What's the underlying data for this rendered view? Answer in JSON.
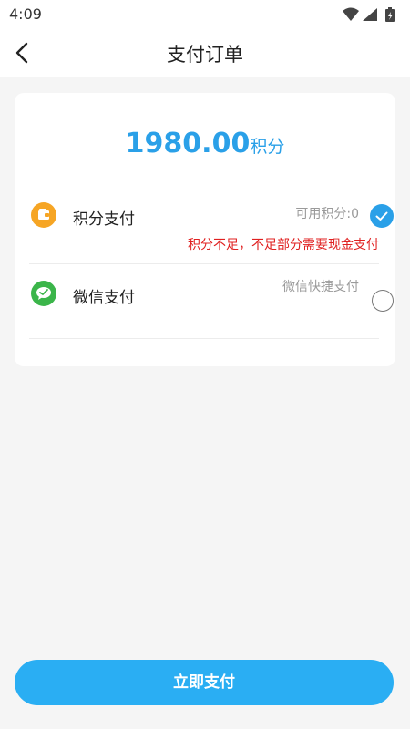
{
  "status_bar": {
    "time": "4:09",
    "icons": [
      "wifi-icon",
      "signal-icon",
      "battery-icon"
    ]
  },
  "header": {
    "back_icon": "chevron-left-icon",
    "title": "支付订单"
  },
  "order": {
    "amount": "1980.00",
    "unit": "积分"
  },
  "payment_methods": [
    {
      "icon": "wallet-icon",
      "label": "积分支付",
      "info": "可用积分:0",
      "warning": "积分不足，不足部分需要现金支付",
      "selected": true
    },
    {
      "icon": "wechat-icon",
      "label": "微信支付",
      "info": "微信快捷支付",
      "selected": false
    }
  ],
  "footer": {
    "pay_button": "立即支付"
  },
  "colors": {
    "accent": "#2aa0e8",
    "button": "#2aaef3",
    "warning": "#e02020",
    "points_icon": "#f6a524",
    "wechat_icon": "#3bb54a"
  }
}
